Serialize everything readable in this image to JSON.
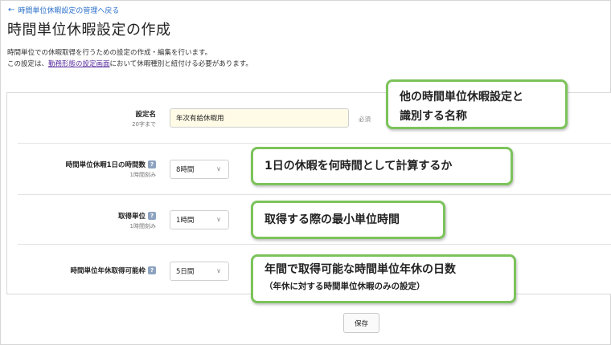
{
  "nav": {
    "back_label": "時間単位休暇設定の管理へ戻る"
  },
  "page": {
    "title": "時間単位休暇設定の作成",
    "desc_line1": "時間単位での休暇取得を行うための設定の作成・編集を行います。",
    "desc_line2_pre": "この設定は、",
    "desc_line2_link": "勤務形態の設定画面",
    "desc_line2_post": "において休暇種別と紐付ける必要があります。"
  },
  "form": {
    "name": {
      "label": "設定名",
      "sub": "20字まで",
      "value": "年次有給休暇用",
      "required": "必須"
    },
    "hours_per_day": {
      "label": "時間単位休暇1日の時間数",
      "sub": "1時間刻み",
      "value": "8時間"
    },
    "unit": {
      "label": "取得単位",
      "sub": "1時間刻み",
      "value": "1時間"
    },
    "annual_limit": {
      "label": "時間単位年休取得可能枠",
      "value": "5日間"
    },
    "help_icon": "?",
    "chevron": "∨"
  },
  "callouts": {
    "c1_line1": "他の時間単位休暇設定と",
    "c1_line2": "識別する名称",
    "c2": "1日の休暇を何時間として計算するか",
    "c3": "取得する際の最小単位時間",
    "c4_line1": "年間で取得可能な時間単位年休の日数",
    "c4_line2": "（年休に対する時間単位休暇のみの設定）"
  },
  "actions": {
    "save_label": "保存"
  },
  "colors": {
    "link": "#2a6fc9",
    "callout_border": "#7cc35b",
    "input_bg": "#fffbe6"
  },
  "icons": {
    "back": "arrow-left-icon",
    "help": "help-icon",
    "chevron": "chevron-down-icon"
  }
}
